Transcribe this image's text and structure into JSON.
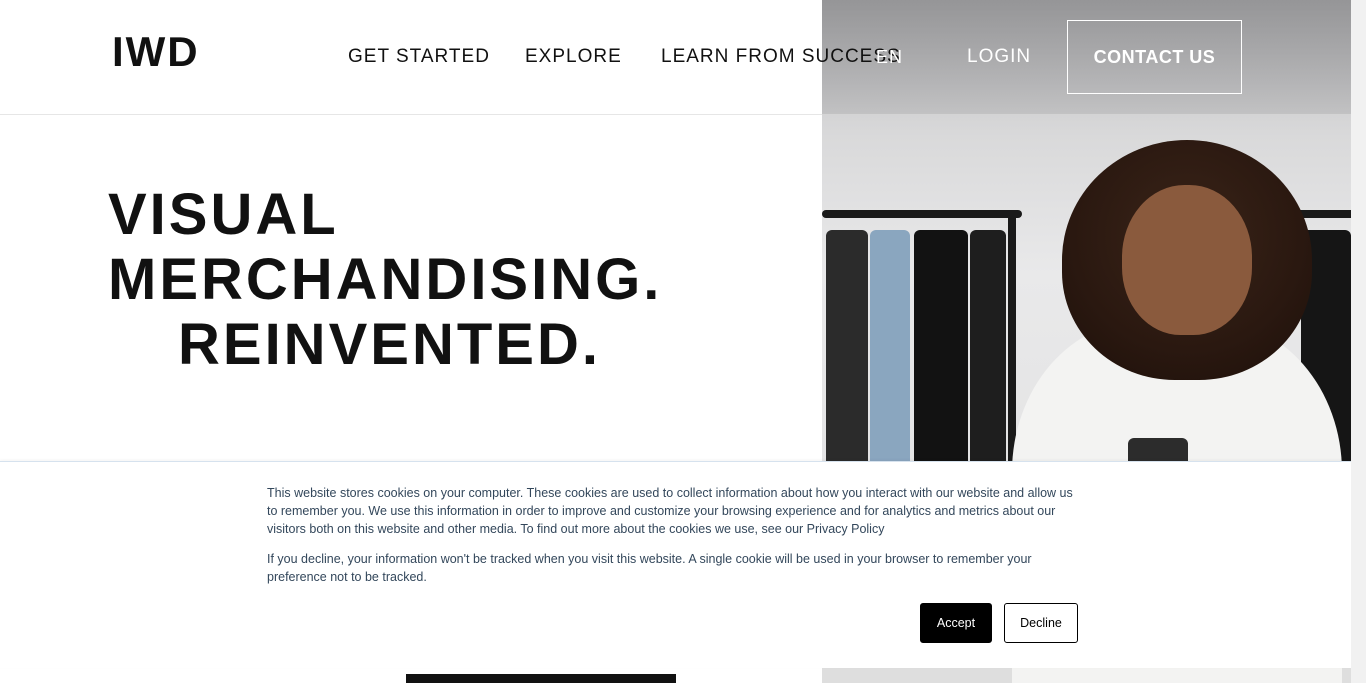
{
  "brand": {
    "logo_text": "IWD"
  },
  "nav": {
    "items": [
      "GET STARTED",
      "EXPLORE",
      "LEARN FROM SUCCESS"
    ],
    "language": "EN",
    "login": "LOGIN",
    "contact": "CONTACT US"
  },
  "hero": {
    "headline": [
      "VISUAL",
      "MERCHANDISING.",
      "REINVENTED."
    ]
  },
  "cookie_banner": {
    "paragraph_1": "This website stores cookies on your computer. These cookies are used to collect information about how you interact with our website and allow us to remember you. We use this information in order to improve and customize your browsing experience and for analytics and metrics about our visitors both on this website and other media. To find out more about the cookies we use, see our Privacy Policy",
    "paragraph_2": "If you decline, your information won't be tracked when you visit this website. A single cookie will be used in your browser to remember your preference not to be tracked.",
    "accept_label": "Accept",
    "decline_label": "Decline"
  },
  "colors": {
    "text": "#111111",
    "banner_text": "#33475b",
    "accept_bg": "#000000"
  }
}
